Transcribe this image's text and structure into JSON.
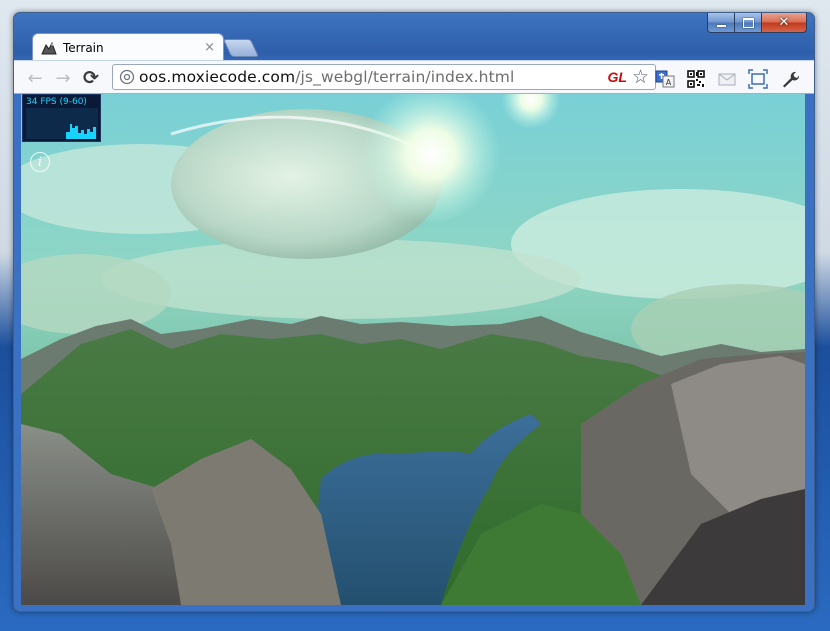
{
  "tab": {
    "title": "Terrain",
    "close": "×"
  },
  "caption": {
    "close": "✕"
  },
  "nav": {
    "back": "←",
    "forward": "→",
    "reload": "⟳"
  },
  "omnibox": {
    "host": "oos.moxiecode.com",
    "path": "/js_webgl/terrain/index.html",
    "gl_badge": "GL",
    "star": "☆"
  },
  "overlay": {
    "fps": "34 FPS (9-60)",
    "info": "i"
  },
  "icons": {
    "favicon": "terrain-favicon",
    "globe": "globe-icon",
    "translate": "translate-icon",
    "qr": "qr-code-icon",
    "mail": "mail-icon",
    "fullscreen": "fullscreen-icon",
    "wrench": "wrench-icon"
  },
  "colors": {
    "titlebar": "#2d5ea9",
    "fps_text": "#19d3ff",
    "gl_badge": "#c01010"
  }
}
